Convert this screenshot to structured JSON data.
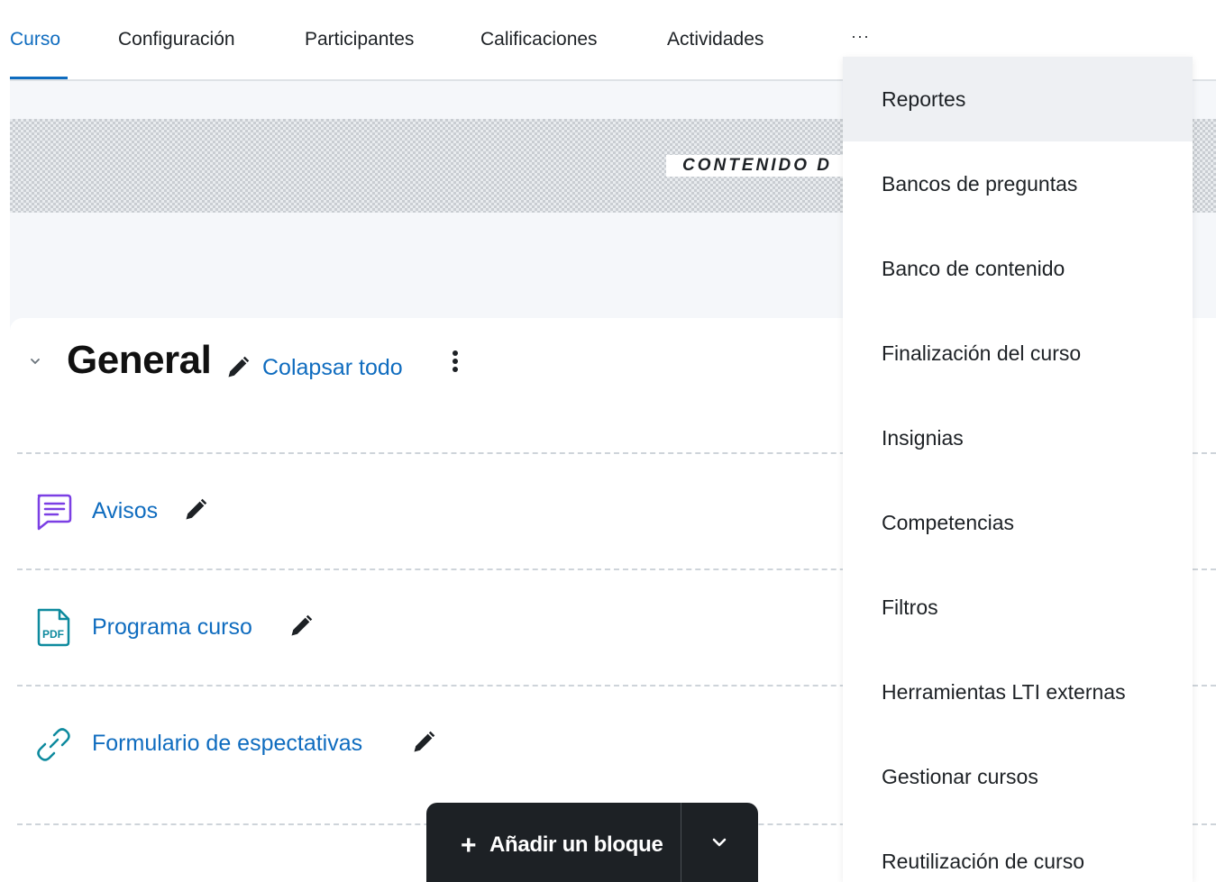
{
  "tabs": [
    {
      "label": "Curso",
      "active": true
    },
    {
      "label": "Configuración"
    },
    {
      "label": "Participantes"
    },
    {
      "label": "Calificaciones"
    },
    {
      "label": "Actividades"
    }
  ],
  "more_label": "···",
  "banner": {
    "text": "CONTENIDO D"
  },
  "section": {
    "title": "General",
    "collapse_label": "Colapsar todo"
  },
  "activities": [
    {
      "label": "Avisos",
      "icon": "forum-icon"
    },
    {
      "label": "Programa curso",
      "icon": "pdf-icon"
    },
    {
      "label": "Formulario de espectativas",
      "icon": "link-icon"
    }
  ],
  "add_block": {
    "plus": "+",
    "label": "Añadir un bloque"
  },
  "more_menu": [
    "Reportes",
    "Bancos de preguntas",
    "Banco de contenido",
    "Finalización del curso",
    "Insignias",
    "Competencias",
    "Filtros",
    "Herramientas LTI externas",
    "Gestionar cursos",
    "Reutilización de curso"
  ],
  "colors": {
    "accent": "#0f6cbf",
    "forum": "#7b3fe4",
    "resource": "#0d8a9e",
    "dark_button": "#1d2125"
  }
}
